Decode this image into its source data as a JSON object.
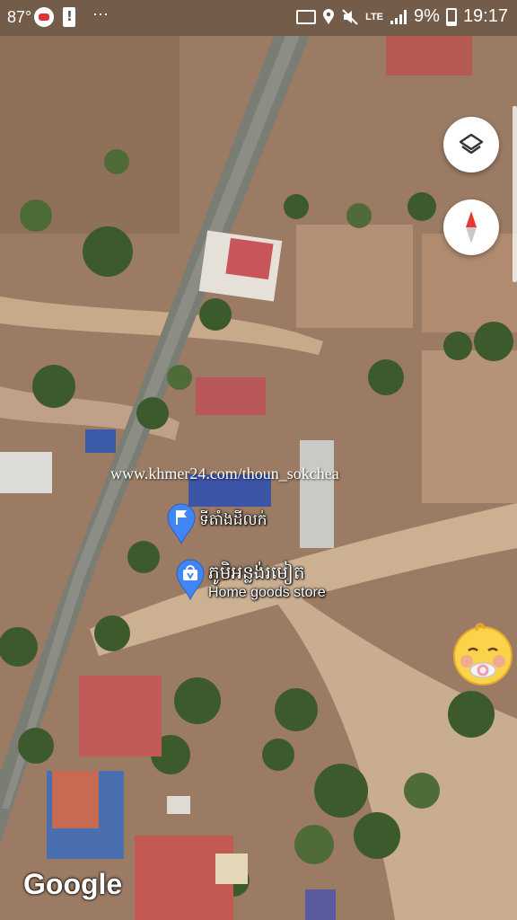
{
  "status_bar": {
    "temperature": "87°",
    "more_icon": "⋯",
    "network": "LTE",
    "battery_percent": "9%",
    "time": "19:17"
  },
  "map": {
    "type": "satellite",
    "watermark": "www.khmer24.com/thoun_sokchea",
    "places": [
      {
        "name": "ទីតាំងដីលក់",
        "icon": "flag-pin"
      },
      {
        "name": "ភូមិអន្លង់រមៀត",
        "category": "Home goods store",
        "icon": "shopping-bag-pin"
      }
    ],
    "attribution": "Google",
    "buttons": {
      "layers": "layers-icon",
      "compass": "compass-icon"
    },
    "accent_colors": {
      "pin_blue": "#4285f4",
      "compass_red": "#e53935"
    }
  },
  "overlay": {
    "icon": "baby-pacifier-emoji"
  }
}
